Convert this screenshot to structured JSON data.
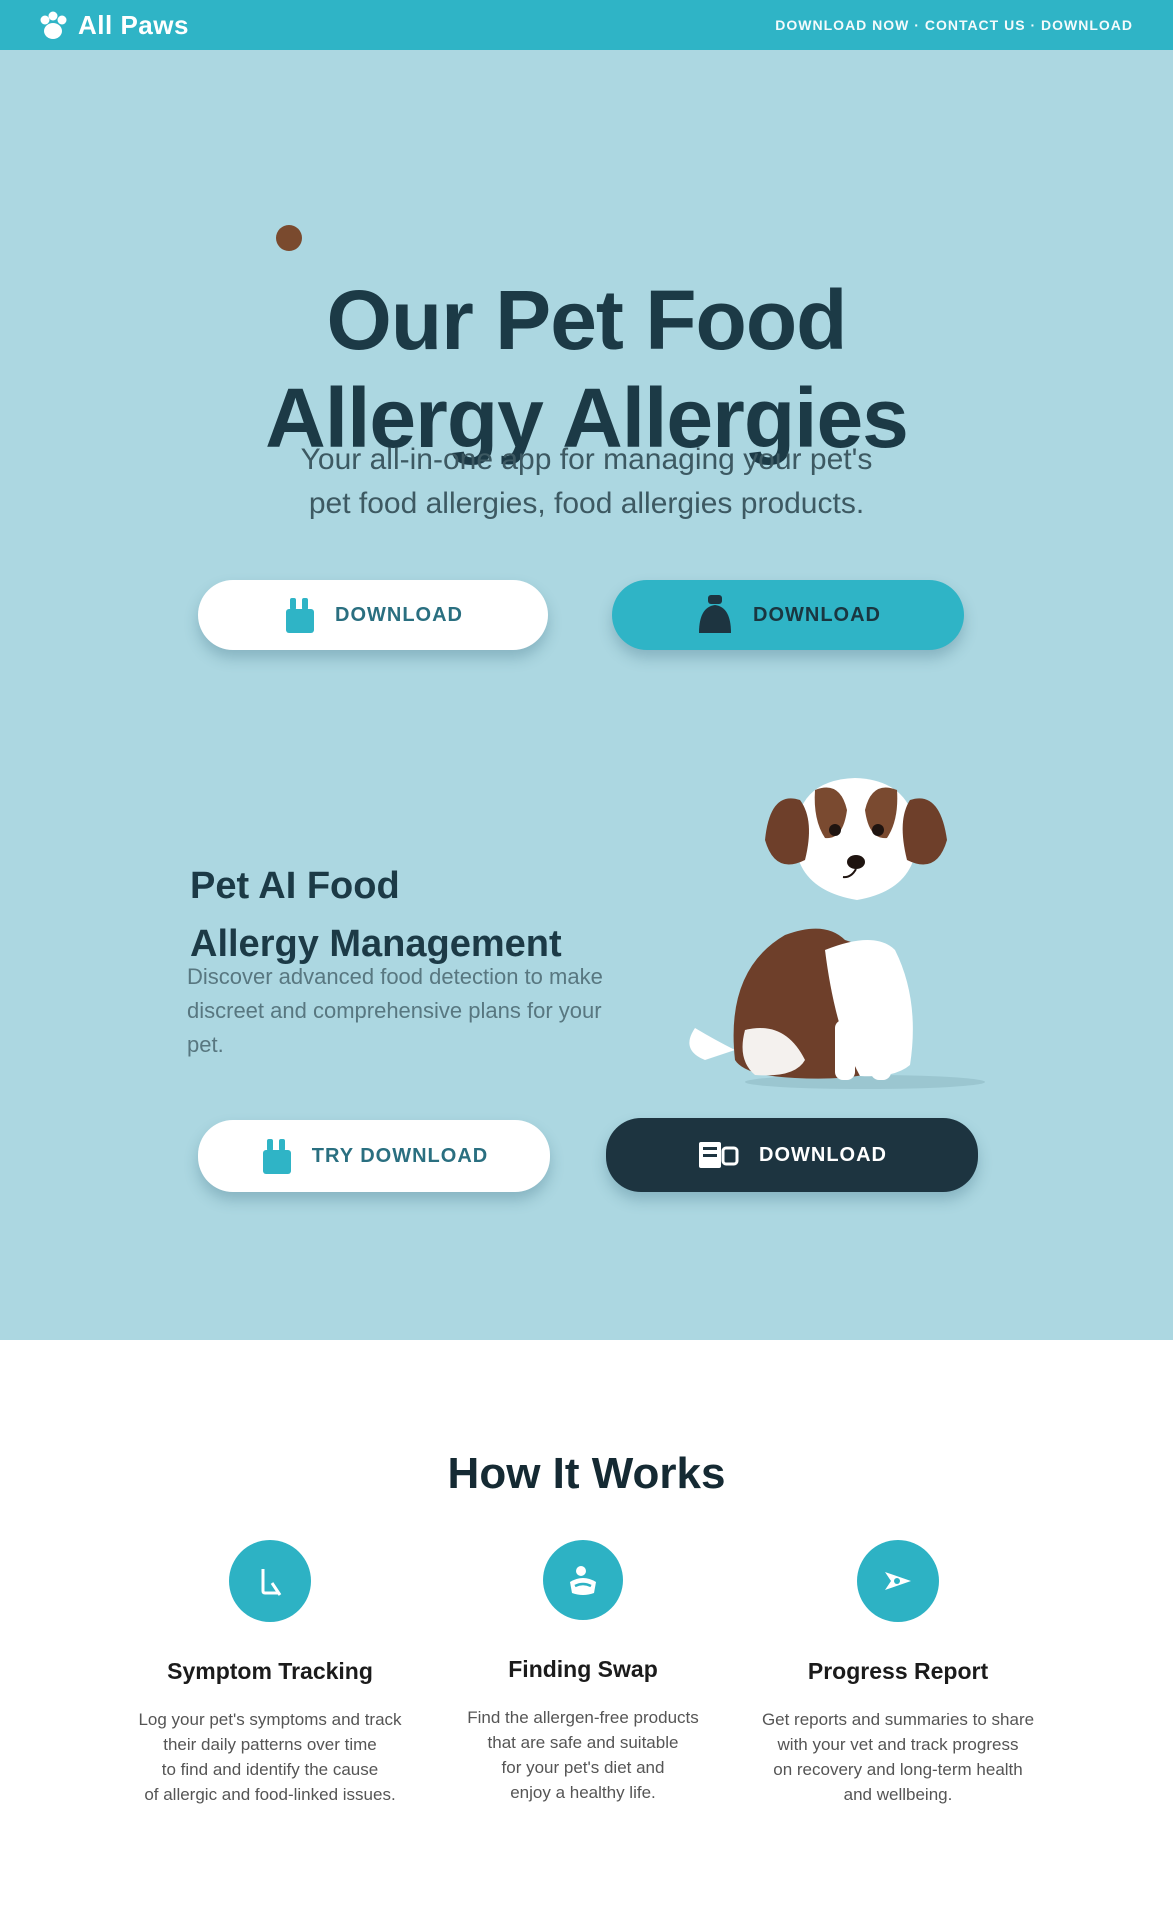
{
  "header": {
    "brand": "All Paws",
    "nav_text": "DOWNLOAD NOW · CONTACT US · DOWNLOAD"
  },
  "hero": {
    "title_lines": [
      "Our Pet Food",
      "Allergy Allergies"
    ],
    "subtitle_lines": [
      "Your all-in-one app for managing your pet's",
      "pet food allergies, food allergies products."
    ],
    "buttons": {
      "primary_label": "DOWNLOAD",
      "secondary_label": "DOWNLOAD"
    }
  },
  "feature": {
    "title_lines": [
      "Pet AI Food",
      "Allergy Management"
    ],
    "text_lines": [
      "Discover advanced food detection to make",
      "discreet and comprehensive plans for your pet."
    ],
    "buttons": {
      "left_label": "TRY DOWNLOAD",
      "right_label": "DOWNLOAD"
    }
  },
  "how_it_works": {
    "title": "How It Works",
    "steps": [
      {
        "title": "Symptom Tracking",
        "icon": "search-document-icon",
        "text_lines": [
          "Log your pet's symptoms and track",
          "their daily patterns over time",
          "to find and identify the cause",
          "of allergic and food-linked issues."
        ]
      },
      {
        "title": "Finding Swap",
        "icon": "food-bowl-icon",
        "text_lines": [
          "Find the allergen-free products",
          "that are safe and suitable",
          "for your pet's diet and",
          "enjoy a healthy life."
        ]
      },
      {
        "title": "Progress Report",
        "icon": "arrow-forward-icon",
        "text_lines": [
          "Get reports and summaries to share",
          "with your vet and track progress",
          "on recovery and long-term health",
          "and wellbeing."
        ]
      }
    ]
  },
  "colors": {
    "header_teal": "#2fb4c6",
    "hero_bg": "#acd7e1",
    "title_dark": "#1c3a46",
    "dark_button": "#1d3440",
    "step_icon_teal": "#2db2c4"
  }
}
